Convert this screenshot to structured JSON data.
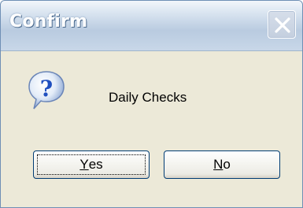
{
  "window": {
    "title": "Confirm",
    "close_icon": "close-icon"
  },
  "dialog": {
    "icon": "question-icon",
    "message": "Daily Checks"
  },
  "buttons": {
    "yes": {
      "mnemonic": "Y",
      "rest": "es"
    },
    "no": {
      "mnemonic": "N",
      "rest": "o"
    }
  },
  "colors": {
    "dialog_bg": "#ECE9D8",
    "button_border": "#003c74",
    "title_text": "#ffffff",
    "question_blue": "#1f4fbf"
  }
}
